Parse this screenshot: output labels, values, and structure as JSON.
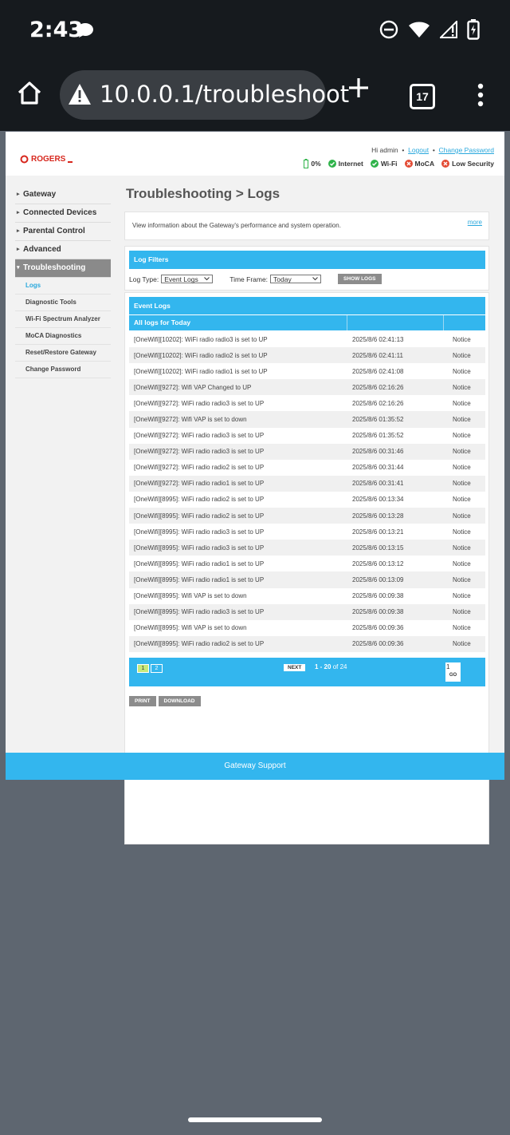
{
  "status_bar": {
    "time": "2:43",
    "icons": [
      "chat-bubble-icon",
      "dnd-icon",
      "wifi-icon",
      "signal-icon",
      "battery-charging-icon"
    ]
  },
  "browser": {
    "url": "10.0.0.1/troubleshoot",
    "tab_count": "17"
  },
  "header": {
    "brand": "ROGERS",
    "greeting": "Hi admin",
    "logout": "Logout",
    "change_password": "Change Password",
    "battery": "0%",
    "statuses": [
      {
        "label": "Internet",
        "state": "ok"
      },
      {
        "label": "Wi-Fi",
        "state": "ok"
      },
      {
        "label": "MoCA",
        "state": "error"
      },
      {
        "label": "Low Security",
        "state": "error"
      }
    ]
  },
  "sidebar": {
    "items": [
      "Gateway",
      "Connected Devices",
      "Parental Control",
      "Advanced",
      "Troubleshooting"
    ],
    "sub_items": [
      "Logs",
      "Diagnostic Tools",
      "Wi-Fi Spectrum Analyzer",
      "MoCA Diagnostics",
      "Reset/Restore Gateway",
      "Change Password"
    ]
  },
  "main": {
    "title": "Troubleshooting > Logs",
    "info_text": "View information about the Gateway's performance and system operation.",
    "more": "more",
    "filters": {
      "header": "Log Filters",
      "log_type_label": "Log Type:",
      "log_type_value": "Event Logs",
      "time_frame_label": "Time Frame:",
      "time_frame_value": "Today",
      "show_button": "SHOW LOGS"
    },
    "logs": {
      "header": "Event Logs",
      "subheader": "All logs for Today",
      "rows": [
        [
          "[OneWifi][10202]: WiFi radio radio3 is set to UP",
          "2025/8/6 02:41:13",
          "Notice"
        ],
        [
          "[OneWifi][10202]: WiFi radio radio2 is set to UP",
          "2025/8/6 02:41:11",
          "Notice"
        ],
        [
          "[OneWifi][10202]: WiFi radio radio1 is set to UP",
          "2025/8/6 02:41:08",
          "Notice"
        ],
        [
          "[OneWifi][9272]: Wifi VAP Changed to UP",
          "2025/8/6 02:16:26",
          "Notice"
        ],
        [
          "[OneWifi][9272]: WiFi radio radio3 is set to UP",
          "2025/8/6 02:16:26",
          "Notice"
        ],
        [
          "[OneWifi][9272]: Wifi VAP is set to down",
          "2025/8/6 01:35:52",
          "Notice"
        ],
        [
          "[OneWifi][9272]: WiFi radio radio3 is set to UP",
          "2025/8/6 01:35:52",
          "Notice"
        ],
        [
          "[OneWifi][9272]: WiFi radio radio3 is set to UP",
          "2025/8/6 00:31:46",
          "Notice"
        ],
        [
          "[OneWifi][9272]: WiFi radio radio2 is set to UP",
          "2025/8/6 00:31:44",
          "Notice"
        ],
        [
          "[OneWifi][9272]: WiFi radio radio1 is set to UP",
          "2025/8/6 00:31:41",
          "Notice"
        ],
        [
          "[OneWifi][8995]: WiFi radio radio2 is set to UP",
          "2025/8/6 00:13:34",
          "Notice"
        ],
        [
          "[OneWifi][8995]: WiFi radio radio2 is set to UP",
          "2025/8/6 00:13:28",
          "Notice"
        ],
        [
          "[OneWifi][8995]: WiFi radio radio3 is set to UP",
          "2025/8/6 00:13:21",
          "Notice"
        ],
        [
          "[OneWifi][8995]: WiFi radio radio3 is set to UP",
          "2025/8/6 00:13:15",
          "Notice"
        ],
        [
          "[OneWifi][8995]: WiFi radio radio1 is set to UP",
          "2025/8/6 00:13:12",
          "Notice"
        ],
        [
          "[OneWifi][8995]: WiFi radio radio1 is set to UP",
          "2025/8/6 00:13:09",
          "Notice"
        ],
        [
          "[OneWifi][8995]: Wifi VAP is set to down",
          "2025/8/6 00:09:38",
          "Notice"
        ],
        [
          "[OneWifi][8995]: WiFi radio radio3 is set to UP",
          "2025/8/6 00:09:38",
          "Notice"
        ],
        [
          "[OneWifi][8995]: Wifi VAP is set to down",
          "2025/8/6 00:09:36",
          "Notice"
        ],
        [
          "[OneWifi][8995]: WiFi radio radio2 is set to UP",
          "2025/8/6 00:09:36",
          "Notice"
        ]
      ],
      "pager": {
        "pages": [
          "1",
          "2"
        ],
        "next": "NEXT",
        "range": "1 - 20",
        "of_label": "of 24",
        "go_input": "1",
        "go": "GO"
      },
      "print": "PRINT",
      "download": "DOWNLOAD"
    }
  },
  "footer": "Gateway Support",
  "colors": {
    "accent": "#33b6ee",
    "brand": "#d7271d",
    "ok": "#2fb34a",
    "error": "#e34b34"
  }
}
